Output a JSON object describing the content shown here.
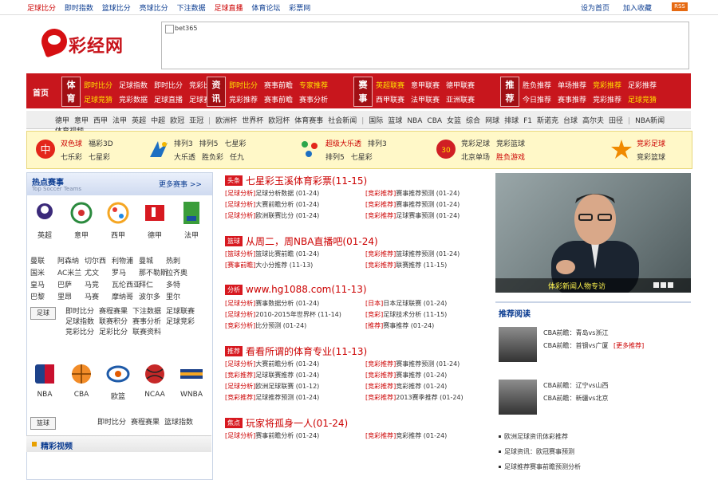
{
  "topbar": {
    "links": [
      "足球比分",
      "即时指数",
      "篮球比分",
      "亮球比分",
      "下注数据",
      "足球直播",
      "体育论坛",
      "彩票网"
    ],
    "right": [
      "设为首页",
      "加入收藏"
    ],
    "rss": "RSS"
  },
  "logo": {
    "text": "彩经网"
  },
  "banner": {
    "alt": "bet365"
  },
  "nav": {
    "home": "首页",
    "blocks": [
      {
        "label": "体育",
        "rows": [
          [
            "即时比分",
            "足球指数",
            "即时比分",
            "竞彩比分"
          ],
          [
            "足球竞猜",
            "竞彩数据",
            "足球直播",
            "足球赛程"
          ]
        ]
      },
      {
        "label": "资讯",
        "rows": [
          [
            "即时比分",
            "赛事前瞻",
            "专家推荐"
          ],
          [
            "竞彩推荐",
            "赛事前瞻",
            "赛事分析"
          ]
        ]
      },
      {
        "label": "赛事",
        "rows": [
          [
            "英超联赛",
            "意甲联赛",
            "德甲联赛"
          ],
          [
            "西甲联赛",
            "法甲联赛",
            "亚洲联赛"
          ]
        ]
      },
      {
        "label": "推荐",
        "rows": [
          [
            "胜负推荐",
            "单场推荐",
            "竞彩推荐",
            "足彩推荐"
          ],
          [
            "今日推荐",
            "赛事推荐",
            "竞彩推荐",
            "足球竞猜"
          ]
        ]
      }
    ]
  },
  "subnav": [
    "德甲",
    "意甲",
    "西甲",
    "法甲",
    "英超",
    "中超",
    "欧冠",
    "亚冠",
    "|",
    "欧洲杯",
    "世界杯",
    "欧冠杯",
    "体育赛事",
    "社会新闻",
    "|",
    "国际",
    "篮球",
    "NBA",
    "CBA",
    "女篮",
    "综合",
    "网球",
    "排球",
    "F1",
    "斯诺克",
    "台球",
    "高尔夫",
    "田径",
    "|",
    "NBA新闻",
    "体育视频"
  ],
  "lotto": [
    {
      "rows": [
        [
          "双色球",
          "福彩3D"
        ],
        [
          "七乐彩",
          "七星彩"
        ]
      ]
    },
    {
      "rows": [
        [
          "排列3",
          "排列5",
          "七星彩"
        ],
        [
          "大乐透",
          "胜负彩",
          "任九"
        ]
      ]
    },
    {
      "rows": [
        [
          "超级大乐透",
          "排列3"
        ],
        [
          "排列5",
          "七星彩"
        ]
      ]
    },
    {
      "rows": [
        [
          "竞彩足球",
          "竞彩篮球"
        ],
        [
          "北京单场",
          "胜负游戏"
        ]
      ]
    },
    {
      "rows": [
        [
          "竞彩足球"
        ],
        [
          "竞彩篮球"
        ]
      ]
    }
  ],
  "hot": {
    "title": "热点赛事",
    "subtitle": "Top Soccer Teams",
    "more": "更多赛事 >>",
    "leagues": [
      "英超",
      "意甲",
      "西甲",
      "德甲",
      "法甲"
    ],
    "teams": [
      [
        "曼联",
        "阿森纳",
        "切尔西",
        "利物浦",
        "曼城",
        "热刺"
      ],
      [
        "国米",
        "AC米兰",
        "尤文",
        "罗马",
        "那不勒斯",
        "拉齐奥"
      ],
      [
        "皇马",
        "巴萨",
        "马竞",
        "瓦伦西亚",
        "拜仁",
        "多特"
      ],
      [
        "巴黎",
        "里昂",
        "马赛",
        "摩纳哥",
        "波尔多",
        "里尔"
      ]
    ],
    "tab1": "足球",
    "tab1_links": [
      [
        "即时比分",
        "赛程赛果",
        "下注数据",
        "足球联赛"
      ],
      [
        "足球指数",
        "联赛积分",
        "赛事分析",
        "足球竞彩"
      ],
      [
        "竞彩比分",
        "足彩比分",
        "联赛资料"
      ]
    ],
    "bb_leagues": [
      "NBA",
      "CBA",
      "欧篮",
      "NCAA",
      "WNBA"
    ],
    "tab2": "篮球",
    "tab2_links": [
      "即时比分",
      "赛程赛果",
      "篮球指数"
    ],
    "highlight": "精彩视频"
  },
  "news": [
    {
      "cat": "头条",
      "headline": "七星彩玉溪体育彩票(11-15)",
      "lines": [
        [
          "[足球分析]",
          "足球分析数据 (01-24)",
          "[竞彩推荐]",
          "赛事推荐预测 (01-24)"
        ],
        [
          "[足球分析]",
          "大赛前瞻分析 (01-24)",
          "[竞彩推荐]",
          "赛事推荐预测 (01-24)"
        ],
        [
          "[足球分析]",
          "欧洲联赛比分 (01-24)",
          "[竞彩推荐]",
          "足球赛事预测 (01-24)"
        ]
      ]
    },
    {
      "cat": "篮球",
      "headline": "从周二，周NBA直播吧(01-24)",
      "lines": [
        [
          "[篮球分析]",
          "篮球比赛前瞻 (01-24)",
          "[竞彩推荐]",
          "篮球推荐预测 (01-24)"
        ],
        [
          "[赛事前瞻]",
          "大小分推荐 (11-13)",
          "[竞彩推荐]",
          "联赛推荐 (11-15)"
        ]
      ]
    },
    {
      "cat": "分析",
      "headline": "www.hg1088.com(11-13)",
      "lines": [
        [
          "[足球分析]",
          "赛事数据分析 (01-24)",
          "[日本]",
          "日本足球联赛 (01-24)"
        ],
        [
          "[足球分析]",
          "2010-2015年世界杯 (11-14)",
          "[竞彩]",
          "足球技术分析 (11-15)"
        ],
        [
          "[竞彩分析]",
          "比分预测 (01-24)",
          "[推荐]",
          "赛事推荐 (01-24)"
        ]
      ]
    },
    {
      "cat": "推荐",
      "headline": "看看所谓的体育专业(11-13)",
      "lines": [
        [
          "[足球分析]",
          "大赛前瞻分析 (01-24)",
          "[竞彩推荐]",
          "赛事推荐预测 (01-24)"
        ],
        [
          "[竞彩推荐]",
          "足球联赛推荐 (01-24)",
          "[竞彩推荐]",
          "赛事推荐 (01-24)"
        ],
        [
          "[足球分析]",
          "欧洲足球联赛 (01-12)",
          "[竞彩推荐]",
          "竞彩推荐 (01-24)"
        ],
        [
          "[竞彩推荐]",
          "足球推荐预测 (01-24)",
          "[竞彩推荐]",
          "2013赛季推荐 (01-24)"
        ]
      ]
    },
    {
      "cat": "焦点",
      "headline": "玩家将孤身一人(01-24)",
      "lines": [
        [
          "[足球分析]",
          "赛事前瞻分析 (01-24)",
          "[竞彩推荐]",
          "竞彩推荐 (01-24)"
        ]
      ]
    }
  ],
  "photo": {
    "caption": "体彩新闻人物专访"
  },
  "rec": {
    "title": "推荐阅读",
    "items": [
      {
        "lines": [
          "CBA前瞻：青岛vs浙江",
          "CBA前瞻：首钢vs广厦",
          "[更多推荐]"
        ]
      },
      {
        "lines": [
          "CBA前瞻：辽宁vs山西",
          "CBA前瞻：新疆vs北京"
        ]
      }
    ],
    "list": [
      "欧洲足球资讯体彩推荐",
      "足球资讯：欧冠赛事预测",
      "足球推荐赛事前瞻预测分析"
    ]
  }
}
